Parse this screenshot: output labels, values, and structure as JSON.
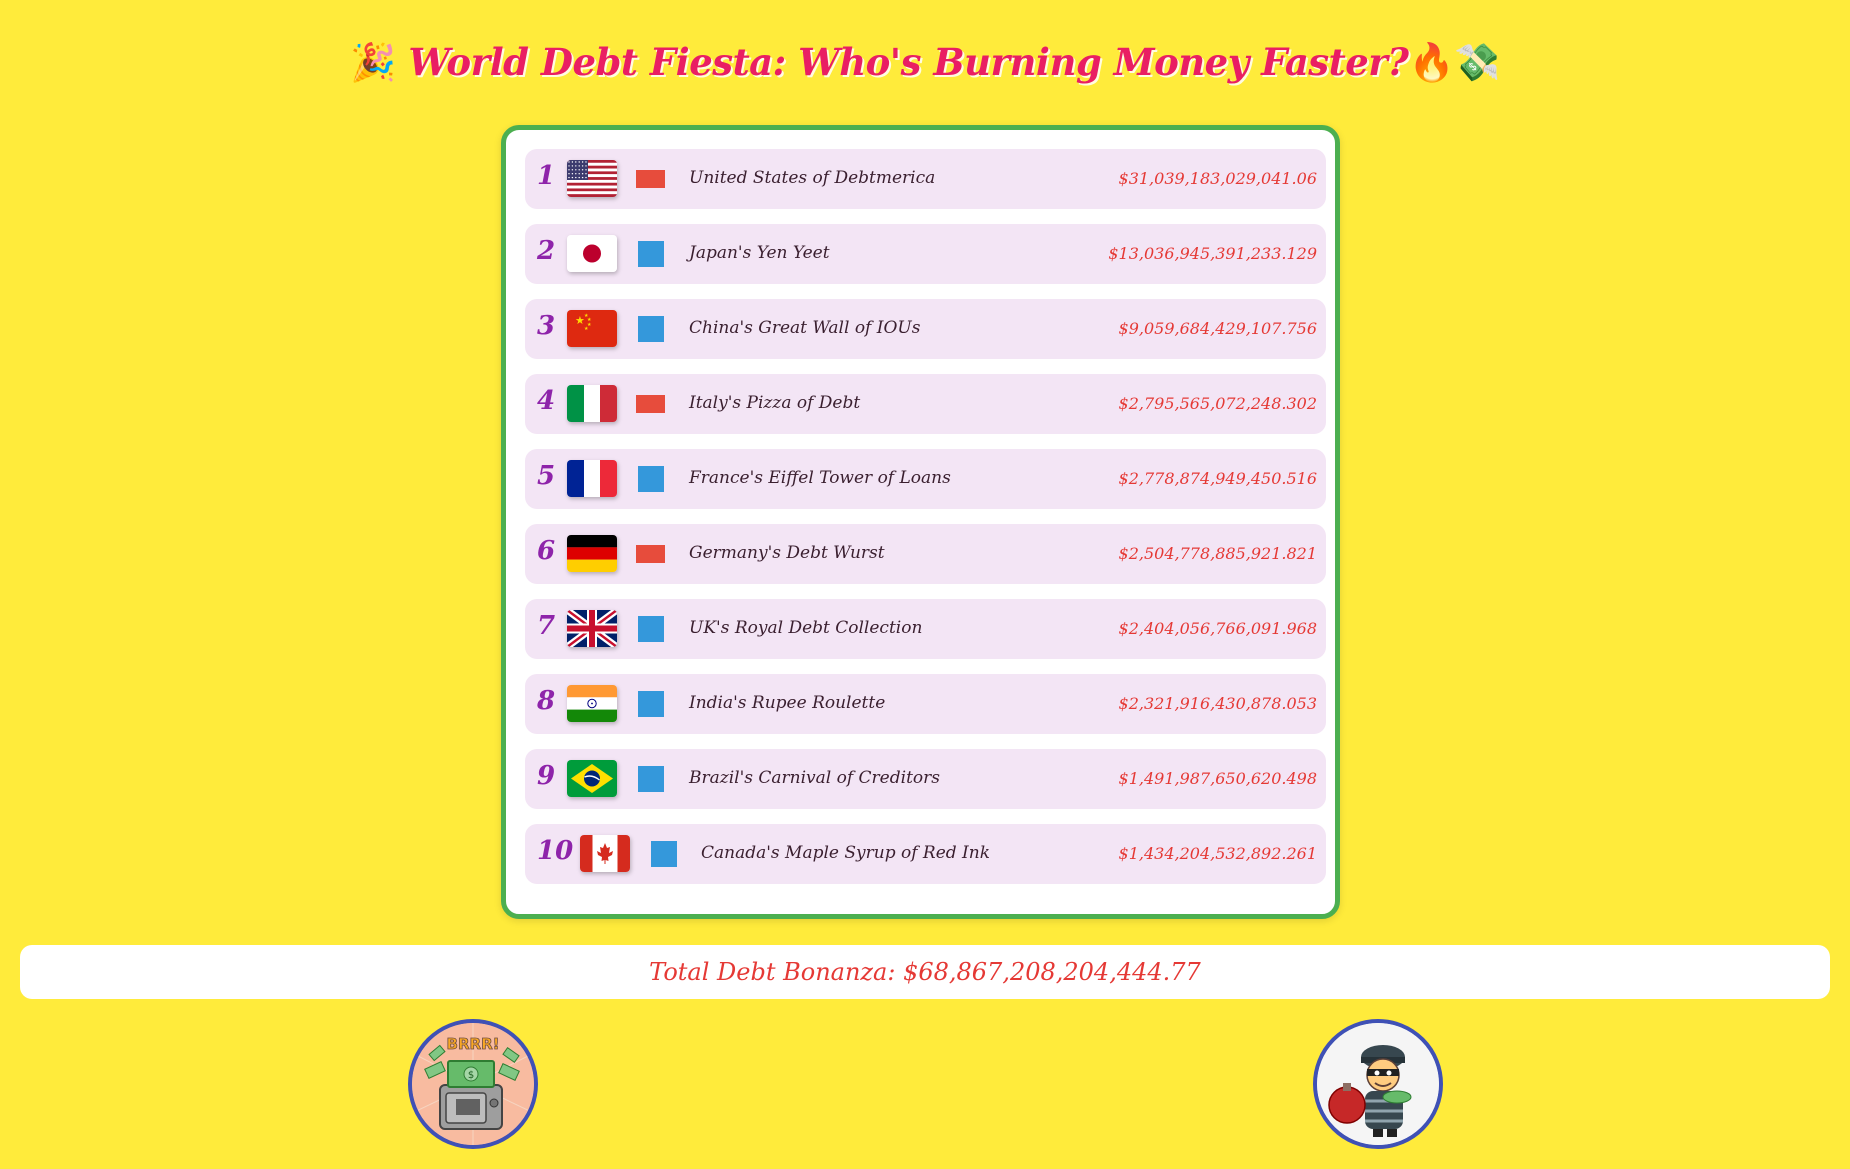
{
  "header": {
    "title_emoji_left": "🎉",
    "title": "World Debt Fiesta: Who's Burning Money Faster?",
    "title_emoji_right": "🔥💸"
  },
  "leaderboard": [
    {
      "rank": "1",
      "flag": "flag-usa-icon",
      "indicator": "red",
      "name": "United States of Debtmerica",
      "debt": "$31,039,183,029,041.06"
    },
    {
      "rank": "2",
      "flag": "flag-japan-icon",
      "indicator": "blue",
      "name": "Japan's Yen Yeet",
      "debt": "$13,036,945,391,233.129"
    },
    {
      "rank": "3",
      "flag": "flag-china-icon",
      "indicator": "blue",
      "name": "China's Great Wall of IOUs",
      "debt": "$9,059,684,429,107.756"
    },
    {
      "rank": "4",
      "flag": "flag-italy-icon",
      "indicator": "red",
      "name": "Italy's Pizza of Debt",
      "debt": "$2,795,565,072,248.302"
    },
    {
      "rank": "5",
      "flag": "flag-france-icon",
      "indicator": "blue",
      "name": "France's Eiffel Tower of Loans",
      "debt": "$2,778,874,949,450.516"
    },
    {
      "rank": "6",
      "flag": "flag-germany-icon",
      "indicator": "red",
      "name": "Germany's Debt Wurst",
      "debt": "$2,504,778,885,921.821"
    },
    {
      "rank": "7",
      "flag": "flag-uk-icon",
      "indicator": "blue",
      "name": "UK's Royal Debt Collection",
      "debt": "$2,404,056,766,091.968"
    },
    {
      "rank": "8",
      "flag": "flag-india-icon",
      "indicator": "blue",
      "name": "India's Rupee Roulette",
      "debt": "$2,321,916,430,878.053"
    },
    {
      "rank": "9",
      "flag": "flag-brazil-icon",
      "indicator": "blue",
      "name": "Brazil's Carnival of Creditors",
      "debt": "$1,491,987,650,620.498"
    },
    {
      "rank": "10",
      "flag": "flag-canada-icon",
      "indicator": "blue",
      "name": "Canada's Maple Syrup of Red Ink",
      "debt": "$1,434,204,532,892.261"
    }
  ],
  "indicator_colors": {
    "red": "#e74c3c",
    "blue": "#3498db"
  },
  "total": {
    "label": "Total Debt Bonanza: $68,867,208,204,444.77"
  },
  "badges": {
    "left": {
      "icon": "money-printer-icon",
      "text": "BRRR!"
    },
    "right": {
      "icon": "money-thief-icon"
    }
  },
  "colors": {
    "background": "#ffeb3b",
    "title": "#e91e63",
    "board_border": "#4caf50",
    "row_bg": "#f3e5f5",
    "rank": "#8e24aa",
    "debt": "#e53935",
    "badge_border": "#3f51b5"
  }
}
